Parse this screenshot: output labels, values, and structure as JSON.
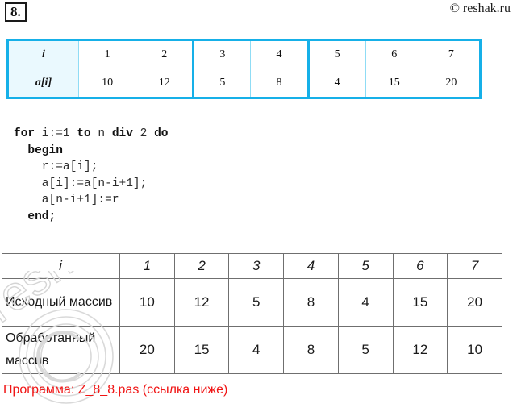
{
  "task": {
    "number_label": "8."
  },
  "watermark": {
    "top_right": "© reshak.ru",
    "diagonal_text": "reshak.ru",
    "copyright_glyph": "©",
    "color": "#d8d8d8"
  },
  "array_table": {
    "row_labels": [
      "i",
      "a[i]"
    ],
    "indices": [
      "1",
      "2",
      "3",
      "4",
      "5",
      "6",
      "7"
    ],
    "values": [
      "10",
      "12",
      "5",
      "8",
      "4",
      "15",
      "20"
    ],
    "border_color": "#16b0e8",
    "label_cell_bg": "#eaf9fe"
  },
  "code": {
    "lines": [
      "for i:=1 to n div 2 do",
      "  begin",
      "    r:=a[i];",
      "    a[i]:=a[n-i+1];",
      "    a[n-i+1]:=r",
      "  end;"
    ],
    "text": "for i:=1 to n div 2 do\n  begin\n    r:=a[i];\n    a[i]:=a[n-i+1];\n    a[n-i+1]:=r\n  end;"
  },
  "result_table": {
    "header": {
      "corner": "i",
      "columns": [
        "1",
        "2",
        "3",
        "4",
        "5",
        "6",
        "7"
      ]
    },
    "rows": [
      {
        "label": "Исходный массив",
        "values": [
          "10",
          "12",
          "5",
          "8",
          "4",
          "15",
          "20"
        ]
      },
      {
        "label": "Обработанный массив",
        "values": [
          "20",
          "15",
          "4",
          "8",
          "5",
          "12",
          "10"
        ]
      }
    ],
    "border_color": "#6f6f6f"
  },
  "footer": {
    "note": "Программа: Z_8_8.pas (ссылка ниже)",
    "color": "#f01414"
  }
}
